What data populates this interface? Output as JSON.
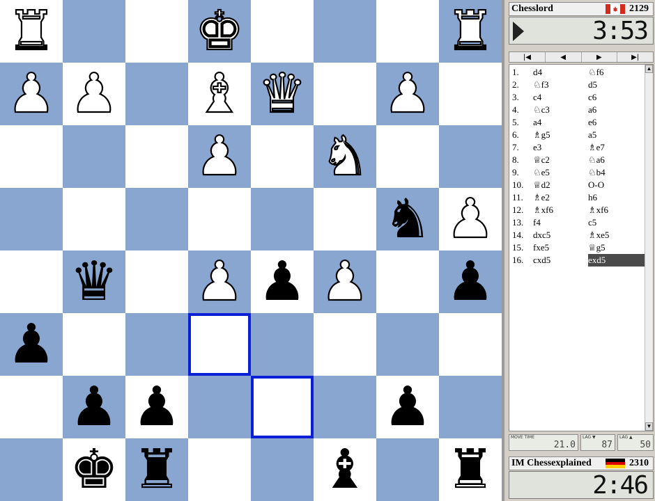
{
  "board": {
    "light_color": "#ffffff",
    "dark_color": "#89a6d1",
    "highlight_color": "#0a1fd6",
    "highlighted_squares": [
      "d6",
      "e7"
    ],
    "pieces": [
      {
        "square": "a1",
        "piece": "white-rook",
        "glyph": "♜"
      },
      {
        "square": "d1",
        "piece": "white-king",
        "glyph": "♚"
      },
      {
        "square": "h1",
        "piece": "white-rook",
        "glyph": "♜"
      },
      {
        "square": "a2",
        "piece": "white-pawn",
        "glyph": "♟"
      },
      {
        "square": "b2",
        "piece": "white-pawn",
        "glyph": "♟"
      },
      {
        "square": "d2",
        "piece": "white-bishop",
        "glyph": "♝"
      },
      {
        "square": "e2",
        "piece": "white-queen",
        "glyph": "♛"
      },
      {
        "square": "g2",
        "piece": "white-pawn",
        "glyph": "♟"
      },
      {
        "square": "d3",
        "piece": "white-pawn",
        "glyph": "♟"
      },
      {
        "square": "f3",
        "piece": "white-knight",
        "glyph": "♞"
      },
      {
        "square": "g4",
        "piece": "black-knight",
        "glyph": "♞"
      },
      {
        "square": "h4",
        "piece": "white-pawn",
        "glyph": "♟"
      },
      {
        "square": "b5",
        "piece": "black-queen",
        "glyph": "♛"
      },
      {
        "square": "d5",
        "piece": "white-pawn",
        "glyph": "♟"
      },
      {
        "square": "e5",
        "piece": "black-pawn",
        "glyph": "♟"
      },
      {
        "square": "f5",
        "piece": "white-pawn",
        "glyph": "♟"
      },
      {
        "square": "h5",
        "piece": "black-pawn",
        "glyph": "♟"
      },
      {
        "square": "a6",
        "piece": "black-pawn",
        "glyph": "♟"
      },
      {
        "square": "b7",
        "piece": "black-pawn",
        "glyph": "♟"
      },
      {
        "square": "c7",
        "piece": "black-pawn",
        "glyph": "♟"
      },
      {
        "square": "g7",
        "piece": "black-pawn",
        "glyph": "♟"
      },
      {
        "square": "b8",
        "piece": "black-king",
        "glyph": "♚"
      },
      {
        "square": "c8",
        "piece": "black-rook",
        "glyph": "♜"
      },
      {
        "square": "f8",
        "piece": "black-bishop",
        "glyph": "♝"
      },
      {
        "square": "h8",
        "piece": "black-rook",
        "glyph": "♜"
      }
    ]
  },
  "top_player": {
    "name": "Chesslord",
    "flag": "canada-flag",
    "rating": "2129",
    "clock": "3:53",
    "to_move_indicator": "play-arrow-icon"
  },
  "bottom_player": {
    "name": "IM Chessexplained",
    "flag": "germany-flag",
    "rating": "2310",
    "clock": "2:46"
  },
  "nav": [
    {
      "label": "|◀",
      "icon": "first-move-icon"
    },
    {
      "label": "◀",
      "icon": "previous-move-icon"
    },
    {
      "label": "▶",
      "icon": "next-move-icon"
    },
    {
      "label": "▶|",
      "icon": "last-move-icon"
    }
  ],
  "moves": [
    {
      "num": "1.",
      "white": "d4",
      "black": "♘f6"
    },
    {
      "num": "2.",
      "white": "♘f3",
      "black": "d5"
    },
    {
      "num": "3.",
      "white": "c4",
      "black": "c6"
    },
    {
      "num": "4.",
      "white": "♘c3",
      "black": "a6"
    },
    {
      "num": "5.",
      "white": "a4",
      "black": "e6"
    },
    {
      "num": "6.",
      "white": "♗g5",
      "black": "a5"
    },
    {
      "num": "7.",
      "white": "e3",
      "black": "♗e7"
    },
    {
      "num": "8.",
      "white": "♕c2",
      "black": "♘a6"
    },
    {
      "num": "9.",
      "white": "♘e5",
      "black": "♘b4"
    },
    {
      "num": "10.",
      "white": "♕d2",
      "black": "O-O"
    },
    {
      "num": "11.",
      "white": "♗e2",
      "black": "h6"
    },
    {
      "num": "12.",
      "white": "♗xf6",
      "black": "♗xf6"
    },
    {
      "num": "13.",
      "white": "f4",
      "black": "c5"
    },
    {
      "num": "14.",
      "white": "dxc5",
      "black": "♗xe5"
    },
    {
      "num": "15.",
      "white": "fxe5",
      "black": "♕g5"
    },
    {
      "num": "16.",
      "white": "cxd5",
      "black": "exd5",
      "selected": true
    }
  ],
  "stats": {
    "move_time_label": "MOVE TIME",
    "move_time": "21.0",
    "lag_label": "LAG ▼",
    "lag": "87",
    "lag2_label": "LAG ▲",
    "lag2": "50"
  }
}
